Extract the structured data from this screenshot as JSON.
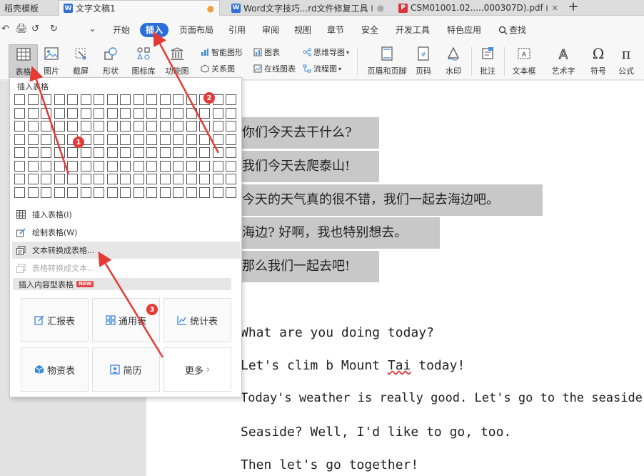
{
  "tabs": [
    {
      "label": "稻壳模板"
    },
    {
      "label": "文字文稿1"
    },
    {
      "label": "Word文字技巧...rd文件修复工具"
    },
    {
      "label": "CSM01001.02.....000307D).pdf"
    }
  ],
  "quick_access": [
    "↶",
    "🖨",
    "↺",
    "↻",
    "⌄"
  ],
  "menu": {
    "items": [
      "开始",
      "插入",
      "页面布局",
      "引用",
      "审阅",
      "视图",
      "章节",
      "安全",
      "开发工具",
      "特色应用"
    ],
    "active": "插入",
    "search": "查找"
  },
  "ribbon": {
    "table": "表格",
    "picture": "图片",
    "screenshot": "截屏",
    "shape": "形状",
    "icon_lib": "图标库",
    "func_chart": "功能图",
    "smart_shape": "智能图形",
    "chart": "图表",
    "mind_map": "思维导图",
    "relation": "关系图",
    "online_chart": "在线图表",
    "flowchart": "流程图",
    "header_footer": "页眉和页脚",
    "page_num": "页码",
    "watermark": "水印",
    "comment": "批注",
    "textbox": "文本框",
    "wordart": "艺术字",
    "symbol": "符号",
    "formula": "公式"
  },
  "panel": {
    "title": "插入表格",
    "grid_cols": 17,
    "grid_rows": 8,
    "items": {
      "insert_table": "插入表格(I)",
      "draw_table": "绘制表格(W)",
      "text_to_table": "文本转换成表格...",
      "table_to_text": "表格转换成文本..."
    },
    "section": "插入内容型表格",
    "new_badge": "NEW",
    "cards": {
      "report": "汇报表",
      "general": "通用表",
      "stats": "统计表",
      "assets": "物资表",
      "resume": "简历",
      "more": "更多"
    }
  },
  "document": {
    "chinese_lines": [
      "你们今天去干什么?",
      "我们今天去爬泰山!",
      "今天的天气真的很不错，我们一起去海边吧。",
      "海边? 好啊，我也特别想去。",
      "那么我们一起去吧!"
    ],
    "english_lines": [
      "What are you doing today?",
      "Let's clim b Mount ",
      "Tai",
      " today!",
      "Today's weather is really good. Let's go to the seaside.",
      "Seaside? Well, I'd like to go, too.",
      "Then let's go together!"
    ]
  },
  "annotations": {
    "badge1": "1",
    "badge2": "2",
    "badge3": "3"
  }
}
